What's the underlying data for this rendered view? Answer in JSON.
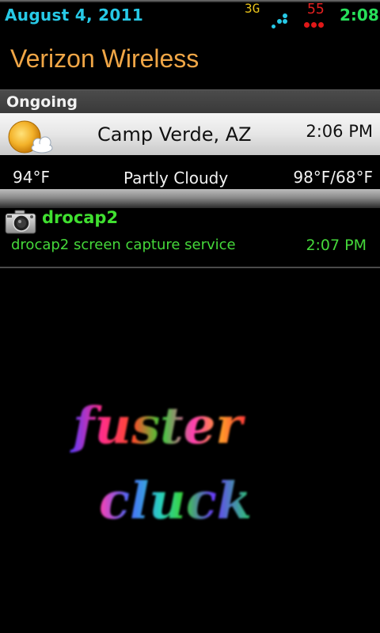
{
  "status_bar": {
    "date": "August 4, 2011",
    "network_type": "3G",
    "battery_level": "55",
    "time": "2:08",
    "network_icon": "data-activity-dots-icon",
    "battery_icon": "battery-dots-icon"
  },
  "carrier": {
    "label": "Verizon Wireless"
  },
  "ongoing": {
    "header": "Ongoing"
  },
  "weather": {
    "icon": "partly-cloudy-icon",
    "location": "Camp Verde, AZ",
    "updated_time": "2:06 PM",
    "temperature": "94°F",
    "condition": "Partly Cloudy",
    "high_low": "98°F/68°F"
  },
  "drocap": {
    "icon": "camera-icon",
    "title": "drocap2",
    "text": "drocap2 screen capture service",
    "time": "2:07 PM"
  },
  "wallpaper": {
    "line1": "fuster",
    "line2": "cluck"
  },
  "colors": {
    "status_date": "#27c9e6",
    "status_time": "#27e05a",
    "network_type": "#e8c21a",
    "battery": "#e02020",
    "carrier": "#f0a646",
    "notification_green": "#45d83a"
  }
}
